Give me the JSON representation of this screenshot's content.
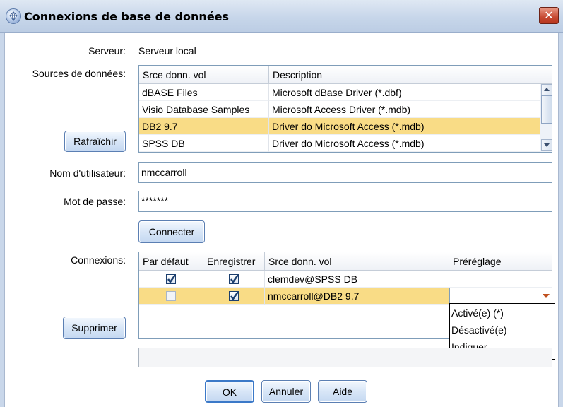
{
  "window": {
    "title": "Connexions de base de données",
    "close_icon": "close-icon"
  },
  "server": {
    "label": "Serveur:",
    "value": "Serveur local"
  },
  "datasources": {
    "label": "Sources de données:",
    "columns": [
      "Srce donn. vol",
      "Description"
    ],
    "rows": [
      [
        "dBASE Files",
        "Microsoft dBase Driver (*.dbf)"
      ],
      [
        "Visio Database Samples",
        "Microsoft Access Driver (*.mdb)"
      ],
      [
        "DB2 9.7",
        "Driver do Microsoft Access (*.mdb)"
      ],
      [
        "SPSS DB",
        "Driver do Microsoft Access (*.mdb)"
      ]
    ],
    "selected_index": 2,
    "refresh_label": "Rafraîchir"
  },
  "username": {
    "label": "Nom d'utilisateur:",
    "value": "nmccarroll"
  },
  "password": {
    "label": "Mot de passe:",
    "value": "*******"
  },
  "connect_label": "Connecter",
  "connections": {
    "label": "Connexions:",
    "columns": [
      "Par défaut",
      "Enregistrer",
      "Srce donn. vol",
      "Préréglage"
    ],
    "rows": [
      {
        "default": true,
        "save": true,
        "source": "clemdev@SPSS DB",
        "preset": ""
      },
      {
        "default": false,
        "save": true,
        "source": "nmccarroll@DB2 9.7",
        "preset": ""
      }
    ],
    "dropdown_options": [
      "Activé(e) (*)",
      "Désactivé(e)",
      "Indiquer..."
    ],
    "delete_label": "Supprimer"
  },
  "footer": {
    "ok_label": "OK",
    "cancel_label": "Annuler",
    "help_label": "Aide"
  },
  "colors": {
    "selection": "#f9dc86",
    "title_gradient": "#c7d6ea",
    "close": "#c74a32"
  }
}
